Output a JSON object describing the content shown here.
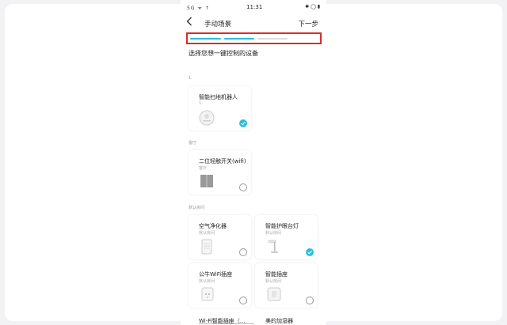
{
  "status_bar": {
    "left": "5G ᯤ ↑",
    "time": "11:31",
    "right": "✱ ◯ ▮"
  },
  "header": {
    "title": "手动场景",
    "next": "下一步"
  },
  "progress": {
    "steps": 3,
    "done": 2,
    "accent": "#27c0db",
    "inactive": "#dddddd"
  },
  "subtitle": "选择您想一键控制的设备",
  "groups": [
    {
      "label": "1"
    },
    {
      "label": "客厅"
    },
    {
      "label": "默认房间"
    }
  ],
  "devices": [
    {
      "name": "智能扫地机器人",
      "room": "1",
      "selected": true,
      "icon": "robot-vacuum-icon"
    },
    {
      "name": "二位轻触开关(wifi)",
      "room": "客厅",
      "selected": false,
      "icon": "wall-switch-icon"
    },
    {
      "name": "空气净化器",
      "room": "默认房间",
      "selected": false,
      "icon": "air-purifier-icon"
    },
    {
      "name": "智能护眼台灯",
      "room": "默认房间",
      "selected": true,
      "icon": "desk-lamp-icon"
    },
    {
      "name": "公牛WiFi插座",
      "room": "默认房间",
      "selected": false,
      "icon": "wifi-socket-icon"
    },
    {
      "name": "智能插座",
      "room": "默认房间",
      "selected": false,
      "icon": "smart-plug-icon"
    },
    {
      "name": "Wi-Fi智能插座（…",
      "room": "",
      "selected": false,
      "icon": ""
    },
    {
      "name": "美的加湿器",
      "room": "",
      "selected": false,
      "icon": ""
    }
  ]
}
